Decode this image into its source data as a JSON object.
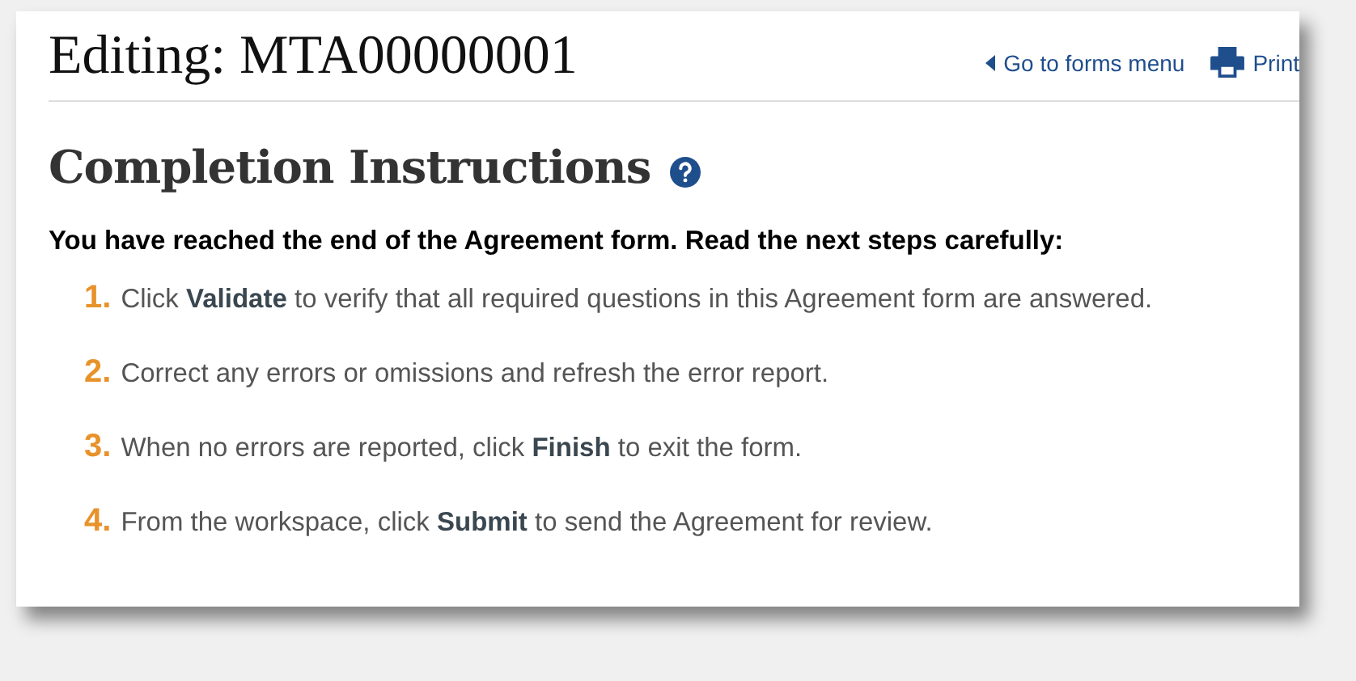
{
  "header": {
    "title": "Editing: MTA00000001",
    "links": [
      {
        "kind": "back",
        "label": "Go to forms menu"
      },
      {
        "kind": "print",
        "label": "Print"
      }
    ]
  },
  "section": {
    "heading": "Completion Instructions",
    "intro": "You have reached the end of the Agreement form. Read the next steps carefully:",
    "steps": [
      {
        "number": "1.",
        "text": "Click **Validate** to verify that all required questions in this Agreement form are answered."
      },
      {
        "number": "2.",
        "text": "Correct any errors or omissions and refresh the error report."
      },
      {
        "number": "3.",
        "text": "When no errors are reported, click **Finish** to exit the form."
      },
      {
        "number": "4.",
        "text": "From the workspace, click **Submit** to send the Agreement for review."
      }
    ]
  }
}
